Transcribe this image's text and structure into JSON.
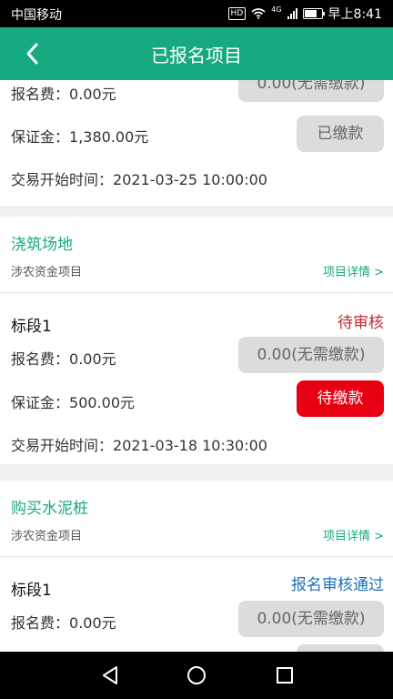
{
  "status_bar": {
    "carrier": "中国移动",
    "hd": "HD",
    "network": "4G",
    "time": "早上8:41",
    "battery_level": 0.75
  },
  "header": {
    "title": "已报名项目"
  },
  "card_top": {
    "reg_fee_label": "报名费：",
    "reg_fee_value": "0.00元",
    "reg_fee_button": "0.00(无需缴款)",
    "deposit_label": "保证金：",
    "deposit_value": "1,380.00元",
    "deposit_button": "已缴款",
    "start_time_label": "交易开始时间：",
    "start_time_value": "2021-03-25 10:00:00"
  },
  "project1": {
    "name": "浇筑场地",
    "type": "涉农资金项目",
    "details_link": "项目详情 >",
    "section": "标段1",
    "status": "待审核",
    "status_color": "#c0272d",
    "reg_fee_label": "报名费：",
    "reg_fee_value": "0.00元",
    "reg_fee_button": "0.00(无需缴款)",
    "deposit_label": "保证金：",
    "deposit_value": "500.00元",
    "deposit_button": "待缴款",
    "start_time_label": "交易开始时间：",
    "start_time_value": "2021-03-18 10:30:00"
  },
  "project2": {
    "name": "购买水泥桩",
    "type": "涉农资金项目",
    "details_link": "项目详情 >",
    "section": "标段1",
    "status": "报名审核通过",
    "status_color": "#1e6fb8",
    "reg_fee_label": "报名费：",
    "reg_fee_value": "0.00元",
    "reg_fee_button": "0.00(无需缴款)"
  },
  "colors": {
    "brand_green": "#17a97f",
    "danger_red": "#e60012"
  },
  "bottom_nav": {
    "icons": [
      "back-triangle-icon",
      "home-circle-icon",
      "recents-square-icon"
    ]
  }
}
